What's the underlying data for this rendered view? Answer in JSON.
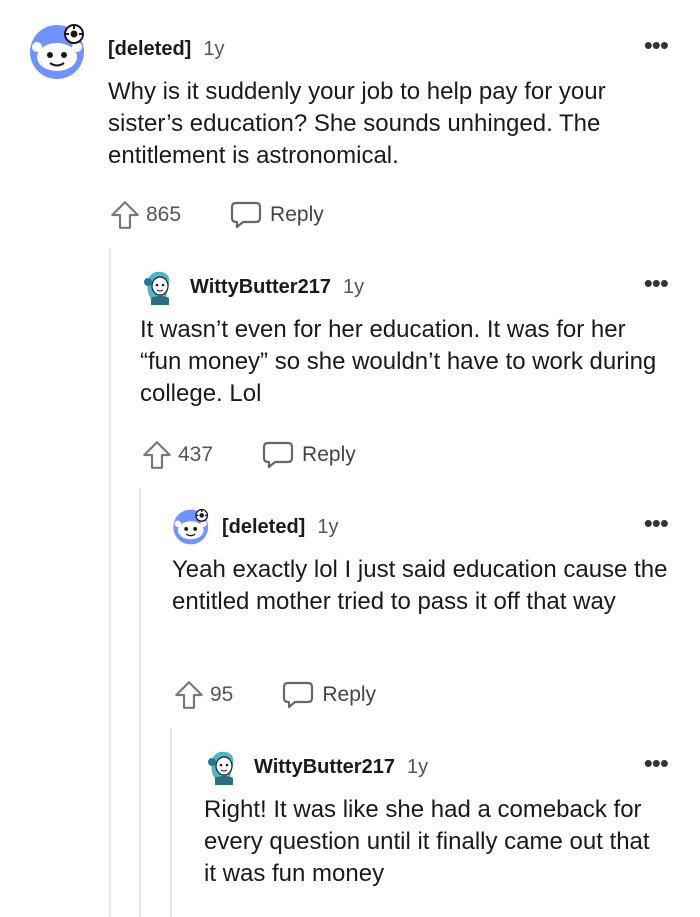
{
  "colors": {
    "text": "#1a1a1b",
    "meta": "#555555",
    "thread_line": "#e6e6e6",
    "snoo_blue": "#7193ff",
    "avatar_teal": "#4fb3c9"
  },
  "comments": [
    {
      "username": "[deleted]",
      "age": "1y",
      "text": "Why is it suddenly your job to help pay for your sister’s education? She sounds unhinged. The entitlement is astronomical.",
      "upvotes": "865",
      "reply_label": "Reply",
      "avatar": "deleted-snoo-icon"
    },
    {
      "username": "WittyButter217",
      "age": "1y",
      "text": "It wasn’t even for her education. It was for her “fun money” so she wouldn’t have to work during college. Lol",
      "upvotes": "437",
      "reply_label": "Reply",
      "avatar": "blue-hair-avatar-icon"
    },
    {
      "username": "[deleted]",
      "age": "1y",
      "text": "Yeah exactly lol I just said education cause the entitled mother tried to pass it off that way",
      "upvotes": "95",
      "reply_label": "Reply",
      "avatar": "deleted-snoo-icon"
    },
    {
      "username": "WittyButter217",
      "age": "1y",
      "text": "Right! It was like she had a comeback for every question until it finally came out that it was fun money",
      "avatar": "blue-hair-avatar-icon"
    }
  ]
}
